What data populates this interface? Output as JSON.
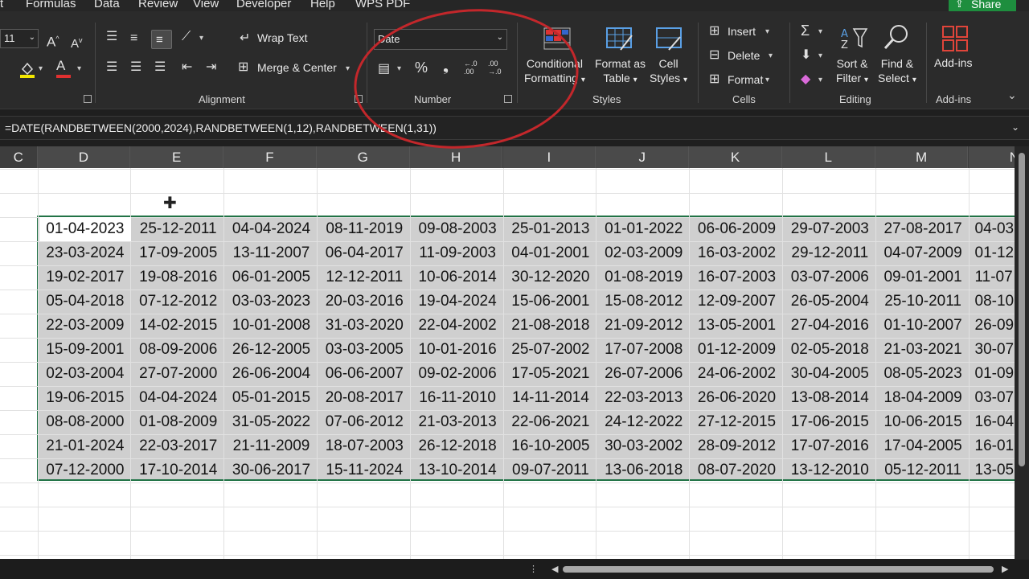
{
  "menu": {
    "items": [
      "t",
      "Formulas",
      "Data",
      "Review",
      "View",
      "Developer",
      "Help",
      "WPS PDF"
    ],
    "share_label": "Share"
  },
  "ribbon": {
    "font": {
      "size_value": "11",
      "grow_label": "A",
      "shrink_label": "A",
      "color_label": "A"
    },
    "alignment": {
      "wrap_text_label": "Wrap Text",
      "merge_center_label": "Merge & Center",
      "group_label": "Alignment"
    },
    "number": {
      "format_value": "Date",
      "percent_label": "%",
      "comma_label": "❟",
      "inc_decimal_label": "←.0 .00",
      "dec_decimal_label": ".00 →.0",
      "group_label": "Number"
    },
    "styles": {
      "conditional_formatting_label": [
        "Conditional",
        "Formatting"
      ],
      "format_as_table_label": [
        "Format as",
        "Table"
      ],
      "cell_styles_label": [
        "Cell",
        "Styles"
      ],
      "group_label": "Styles"
    },
    "cells": {
      "insert_label": "Insert",
      "delete_label": "Delete",
      "format_label": "Format",
      "group_label": "Cells"
    },
    "editing": {
      "sort_filter_label": [
        "Sort &",
        "Filter"
      ],
      "find_select_label": [
        "Find &",
        "Select"
      ],
      "group_label": "Editing"
    },
    "addins": {
      "label": "Add-ins",
      "group_label": "Add-ins"
    }
  },
  "formula_bar": {
    "text": "=DATE(RANDBETWEEN(2000,2024),RANDBETWEEN(1,12),RANDBETWEEN(1,31))"
  },
  "sheet": {
    "columns": [
      "C",
      "D",
      "E",
      "F",
      "G",
      "H",
      "I",
      "J",
      "K",
      "L",
      "M",
      "N"
    ],
    "selected_columns": [
      "D",
      "E",
      "F",
      "G",
      "H",
      "I",
      "J",
      "K",
      "L",
      "M",
      "N"
    ],
    "rows": [
      [
        "01-04-2023",
        "25-12-2011",
        "04-04-2024",
        "08-11-2019",
        "09-08-2003",
        "25-01-2013",
        "01-01-2022",
        "06-06-2009",
        "29-07-2003",
        "27-08-2017",
        "04-03"
      ],
      [
        "23-03-2024",
        "17-09-2005",
        "13-11-2007",
        "06-04-2017",
        "11-09-2003",
        "04-01-2001",
        "02-03-2009",
        "16-03-2002",
        "29-12-2011",
        "04-07-2009",
        "01-12"
      ],
      [
        "19-02-2017",
        "19-08-2016",
        "06-01-2005",
        "12-12-2011",
        "10-06-2014",
        "30-12-2020",
        "01-08-2019",
        "16-07-2003",
        "03-07-2006",
        "09-01-2001",
        "11-07"
      ],
      [
        "05-04-2018",
        "07-12-2012",
        "03-03-2023",
        "20-03-2016",
        "19-04-2024",
        "15-06-2001",
        "15-08-2012",
        "12-09-2007",
        "26-05-2004",
        "25-10-2011",
        "08-10"
      ],
      [
        "22-03-2009",
        "14-02-2015",
        "10-01-2008",
        "31-03-2020",
        "22-04-2002",
        "21-08-2018",
        "21-09-2012",
        "13-05-2001",
        "27-04-2016",
        "01-10-2007",
        "26-09"
      ],
      [
        "15-09-2001",
        "08-09-2006",
        "26-12-2005",
        "03-03-2005",
        "10-01-2016",
        "25-07-2002",
        "17-07-2008",
        "01-12-2009",
        "02-05-2018",
        "21-03-2021",
        "30-07"
      ],
      [
        "02-03-2004",
        "27-07-2000",
        "26-06-2004",
        "06-06-2007",
        "09-02-2006",
        "17-05-2021",
        "26-07-2006",
        "24-06-2002",
        "30-04-2005",
        "08-05-2023",
        "01-09"
      ],
      [
        "19-06-2015",
        "04-04-2024",
        "05-01-2015",
        "20-08-2017",
        "16-11-2010",
        "14-11-2014",
        "22-03-2013",
        "26-06-2020",
        "13-08-2014",
        "18-04-2009",
        "03-07"
      ],
      [
        "08-08-2000",
        "01-08-2009",
        "31-05-2022",
        "07-06-2012",
        "21-03-2013",
        "22-06-2021",
        "24-12-2022",
        "27-12-2015",
        "17-06-2015",
        "10-06-2015",
        "16-04"
      ],
      [
        "21-01-2024",
        "22-03-2017",
        "21-11-2009",
        "18-07-2003",
        "26-12-2018",
        "16-10-2005",
        "30-03-2002",
        "28-09-2012",
        "17-07-2016",
        "17-04-2005",
        "16-01"
      ],
      [
        "07-12-2000",
        "17-10-2014",
        "30-06-2017",
        "15-11-2024",
        "13-10-2014",
        "09-07-2011",
        "13-06-2018",
        "08-07-2020",
        "13-12-2010",
        "05-12-2011",
        "13-05"
      ]
    ]
  },
  "colors": {
    "selection_border": "#217346",
    "annotation_circle": "#c3272b",
    "share_button": "#1e8e3e"
  }
}
